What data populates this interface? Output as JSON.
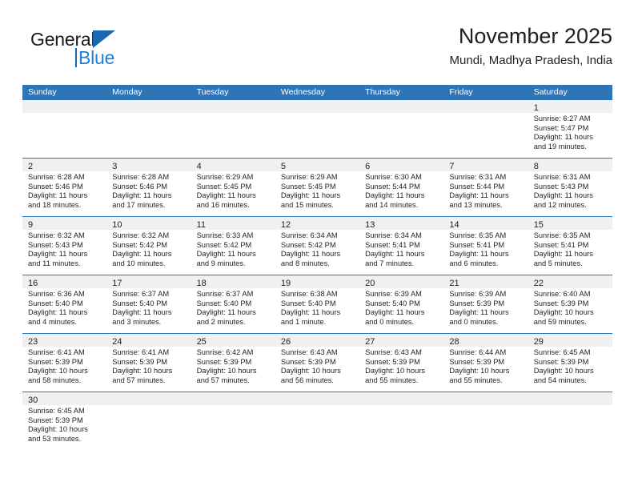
{
  "brand": {
    "name_top": "General",
    "name_bottom": "Blue",
    "logo_icon": "triangle-logo-icon",
    "color_dark": "#1a1a1a",
    "color_blue": "#1f7fd4"
  },
  "header": {
    "title": "November 2025",
    "subtitle": "Mundi, Madhya Pradesh, India"
  },
  "theme": {
    "header_blue": "#2f74b5",
    "daynum_band": "#f0f0f0",
    "text": "#231f20"
  },
  "weekdays": [
    "Sunday",
    "Monday",
    "Tuesday",
    "Wednesday",
    "Thursday",
    "Friday",
    "Saturday"
  ],
  "weeks": [
    [
      {
        "empty": true
      },
      {
        "empty": true
      },
      {
        "empty": true
      },
      {
        "empty": true
      },
      {
        "empty": true
      },
      {
        "empty": true
      },
      {
        "day": "1",
        "sunrise": "Sunrise: 6:27 AM",
        "sunset": "Sunset: 5:47 PM",
        "daylight1": "Daylight: 11 hours",
        "daylight2": "and 19 minutes."
      }
    ],
    [
      {
        "day": "2",
        "sunrise": "Sunrise: 6:28 AM",
        "sunset": "Sunset: 5:46 PM",
        "daylight1": "Daylight: 11 hours",
        "daylight2": "and 18 minutes."
      },
      {
        "day": "3",
        "sunrise": "Sunrise: 6:28 AM",
        "sunset": "Sunset: 5:46 PM",
        "daylight1": "Daylight: 11 hours",
        "daylight2": "and 17 minutes."
      },
      {
        "day": "4",
        "sunrise": "Sunrise: 6:29 AM",
        "sunset": "Sunset: 5:45 PM",
        "daylight1": "Daylight: 11 hours",
        "daylight2": "and 16 minutes."
      },
      {
        "day": "5",
        "sunrise": "Sunrise: 6:29 AM",
        "sunset": "Sunset: 5:45 PM",
        "daylight1": "Daylight: 11 hours",
        "daylight2": "and 15 minutes."
      },
      {
        "day": "6",
        "sunrise": "Sunrise: 6:30 AM",
        "sunset": "Sunset: 5:44 PM",
        "daylight1": "Daylight: 11 hours",
        "daylight2": "and 14 minutes."
      },
      {
        "day": "7",
        "sunrise": "Sunrise: 6:31 AM",
        "sunset": "Sunset: 5:44 PM",
        "daylight1": "Daylight: 11 hours",
        "daylight2": "and 13 minutes."
      },
      {
        "day": "8",
        "sunrise": "Sunrise: 6:31 AM",
        "sunset": "Sunset: 5:43 PM",
        "daylight1": "Daylight: 11 hours",
        "daylight2": "and 12 minutes."
      }
    ],
    [
      {
        "day": "9",
        "sunrise": "Sunrise: 6:32 AM",
        "sunset": "Sunset: 5:43 PM",
        "daylight1": "Daylight: 11 hours",
        "daylight2": "and 11 minutes."
      },
      {
        "day": "10",
        "sunrise": "Sunrise: 6:32 AM",
        "sunset": "Sunset: 5:42 PM",
        "daylight1": "Daylight: 11 hours",
        "daylight2": "and 10 minutes."
      },
      {
        "day": "11",
        "sunrise": "Sunrise: 6:33 AM",
        "sunset": "Sunset: 5:42 PM",
        "daylight1": "Daylight: 11 hours",
        "daylight2": "and 9 minutes."
      },
      {
        "day": "12",
        "sunrise": "Sunrise: 6:34 AM",
        "sunset": "Sunset: 5:42 PM",
        "daylight1": "Daylight: 11 hours",
        "daylight2": "and 8 minutes."
      },
      {
        "day": "13",
        "sunrise": "Sunrise: 6:34 AM",
        "sunset": "Sunset: 5:41 PM",
        "daylight1": "Daylight: 11 hours",
        "daylight2": "and 7 minutes."
      },
      {
        "day": "14",
        "sunrise": "Sunrise: 6:35 AM",
        "sunset": "Sunset: 5:41 PM",
        "daylight1": "Daylight: 11 hours",
        "daylight2": "and 6 minutes."
      },
      {
        "day": "15",
        "sunrise": "Sunrise: 6:35 AM",
        "sunset": "Sunset: 5:41 PM",
        "daylight1": "Daylight: 11 hours",
        "daylight2": "and 5 minutes."
      }
    ],
    [
      {
        "day": "16",
        "sunrise": "Sunrise: 6:36 AM",
        "sunset": "Sunset: 5:40 PM",
        "daylight1": "Daylight: 11 hours",
        "daylight2": "and 4 minutes."
      },
      {
        "day": "17",
        "sunrise": "Sunrise: 6:37 AM",
        "sunset": "Sunset: 5:40 PM",
        "daylight1": "Daylight: 11 hours",
        "daylight2": "and 3 minutes."
      },
      {
        "day": "18",
        "sunrise": "Sunrise: 6:37 AM",
        "sunset": "Sunset: 5:40 PM",
        "daylight1": "Daylight: 11 hours",
        "daylight2": "and 2 minutes."
      },
      {
        "day": "19",
        "sunrise": "Sunrise: 6:38 AM",
        "sunset": "Sunset: 5:40 PM",
        "daylight1": "Daylight: 11 hours",
        "daylight2": "and 1 minute."
      },
      {
        "day": "20",
        "sunrise": "Sunrise: 6:39 AM",
        "sunset": "Sunset: 5:40 PM",
        "daylight1": "Daylight: 11 hours",
        "daylight2": "and 0 minutes."
      },
      {
        "day": "21",
        "sunrise": "Sunrise: 6:39 AM",
        "sunset": "Sunset: 5:39 PM",
        "daylight1": "Daylight: 11 hours",
        "daylight2": "and 0 minutes."
      },
      {
        "day": "22",
        "sunrise": "Sunrise: 6:40 AM",
        "sunset": "Sunset: 5:39 PM",
        "daylight1": "Daylight: 10 hours",
        "daylight2": "and 59 minutes."
      }
    ],
    [
      {
        "day": "23",
        "sunrise": "Sunrise: 6:41 AM",
        "sunset": "Sunset: 5:39 PM",
        "daylight1": "Daylight: 10 hours",
        "daylight2": "and 58 minutes."
      },
      {
        "day": "24",
        "sunrise": "Sunrise: 6:41 AM",
        "sunset": "Sunset: 5:39 PM",
        "daylight1": "Daylight: 10 hours",
        "daylight2": "and 57 minutes."
      },
      {
        "day": "25",
        "sunrise": "Sunrise: 6:42 AM",
        "sunset": "Sunset: 5:39 PM",
        "daylight1": "Daylight: 10 hours",
        "daylight2": "and 57 minutes."
      },
      {
        "day": "26",
        "sunrise": "Sunrise: 6:43 AM",
        "sunset": "Sunset: 5:39 PM",
        "daylight1": "Daylight: 10 hours",
        "daylight2": "and 56 minutes."
      },
      {
        "day": "27",
        "sunrise": "Sunrise: 6:43 AM",
        "sunset": "Sunset: 5:39 PM",
        "daylight1": "Daylight: 10 hours",
        "daylight2": "and 55 minutes."
      },
      {
        "day": "28",
        "sunrise": "Sunrise: 6:44 AM",
        "sunset": "Sunset: 5:39 PM",
        "daylight1": "Daylight: 10 hours",
        "daylight2": "and 55 minutes."
      },
      {
        "day": "29",
        "sunrise": "Sunrise: 6:45 AM",
        "sunset": "Sunset: 5:39 PM",
        "daylight1": "Daylight: 10 hours",
        "daylight2": "and 54 minutes."
      }
    ],
    [
      {
        "day": "30",
        "sunrise": "Sunrise: 6:45 AM",
        "sunset": "Sunset: 5:39 PM",
        "daylight1": "Daylight: 10 hours",
        "daylight2": "and 53 minutes."
      },
      {
        "empty": true
      },
      {
        "empty": true
      },
      {
        "empty": true
      },
      {
        "empty": true
      },
      {
        "empty": true
      },
      {
        "empty": true
      }
    ]
  ]
}
